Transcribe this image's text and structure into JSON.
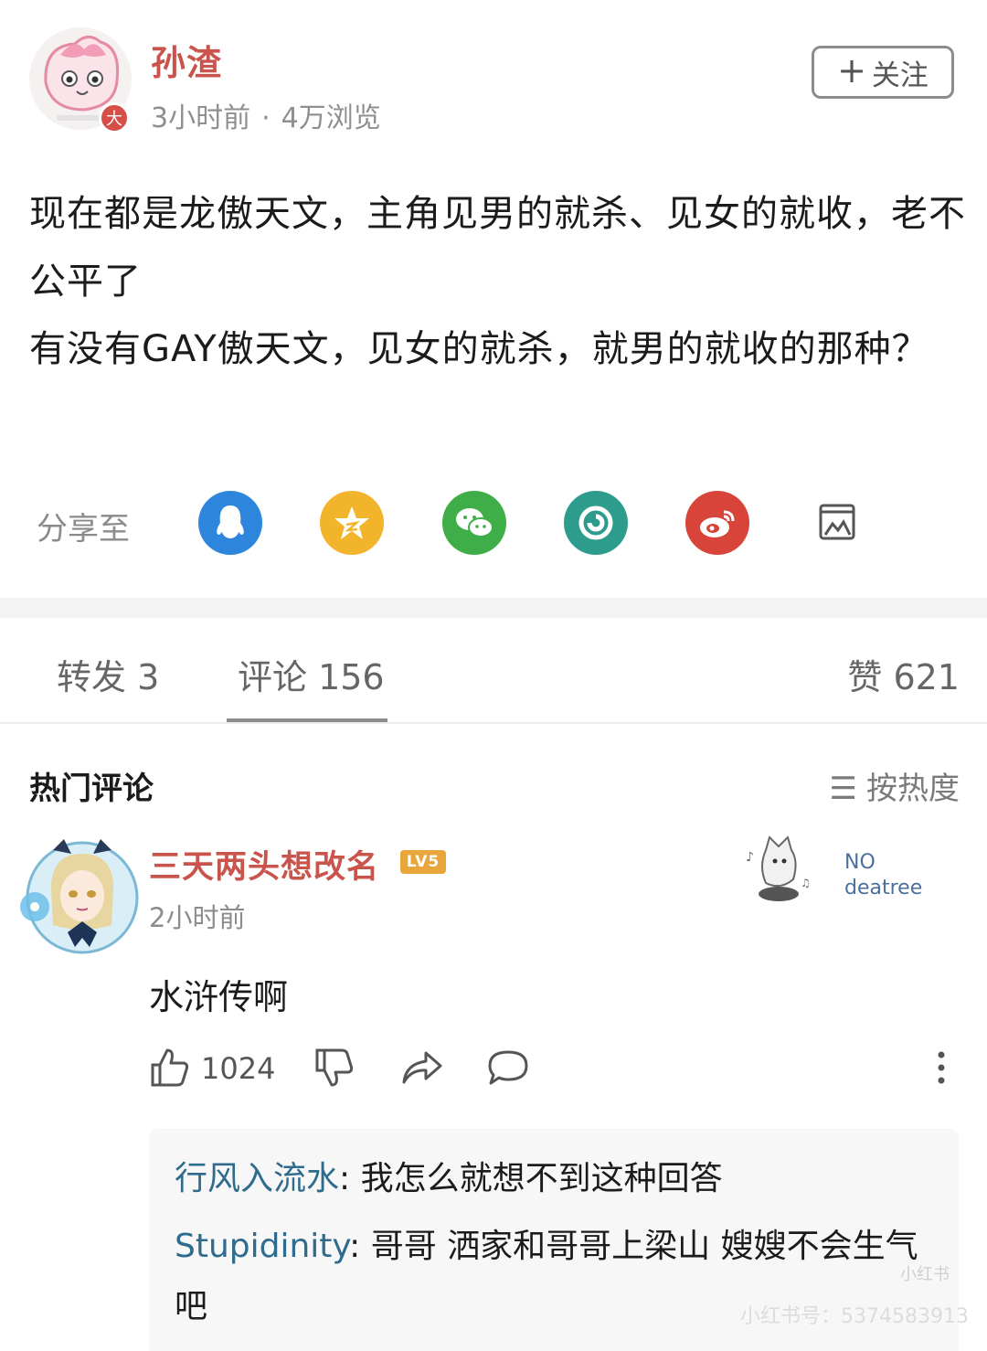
{
  "post": {
    "author": "孙渣",
    "time": "3小时前",
    "separator": "·",
    "views": "4万浏览",
    "follow_label": "关注",
    "follow_icon": "plus-icon",
    "content": "现在都是龙傲天文，主角见男的就杀、见女的就收，老不公平了\n有没有GAY傲天文，见女的就杀，就男的就收的那种？",
    "avatar_badge": "大"
  },
  "share": {
    "label": "分享至",
    "targets": [
      "qq-icon",
      "qzone-icon",
      "wechat-icon",
      "moments-icon",
      "weibo-icon",
      "image-icon"
    ]
  },
  "tabs": {
    "repost": "转发 3",
    "comments": "评论 156",
    "likes": "赞 621"
  },
  "hot_comments": {
    "title": "热门评论",
    "sort_icon": "☰",
    "sort_label": "按热度"
  },
  "comment": {
    "user": "三天两头想改名",
    "badge": "LV5",
    "time": "2小时前",
    "sticker_line1": "NO",
    "sticker_line2": "deatree",
    "text": "水浒传啊",
    "like_count": "1024",
    "replies": [
      {
        "user": "行风入流水",
        "text": "我怎么就想不到这种回答"
      },
      {
        "user": "Stupidinity",
        "text": "哥哥 洒家和哥哥上梁山 嫂嫂不会生气吧"
      }
    ]
  },
  "watermark": {
    "logo": "小红书",
    "id_text": "小红书号：5374583913"
  },
  "colors": {
    "author_red": "#c9544c",
    "reply_user_blue": "#2f6b8c",
    "qq": "#2e86dc",
    "qzone": "#f2b42a",
    "wechat": "#3fae48",
    "moments": "#2e9c8c",
    "weibo": "#d8433a"
  }
}
